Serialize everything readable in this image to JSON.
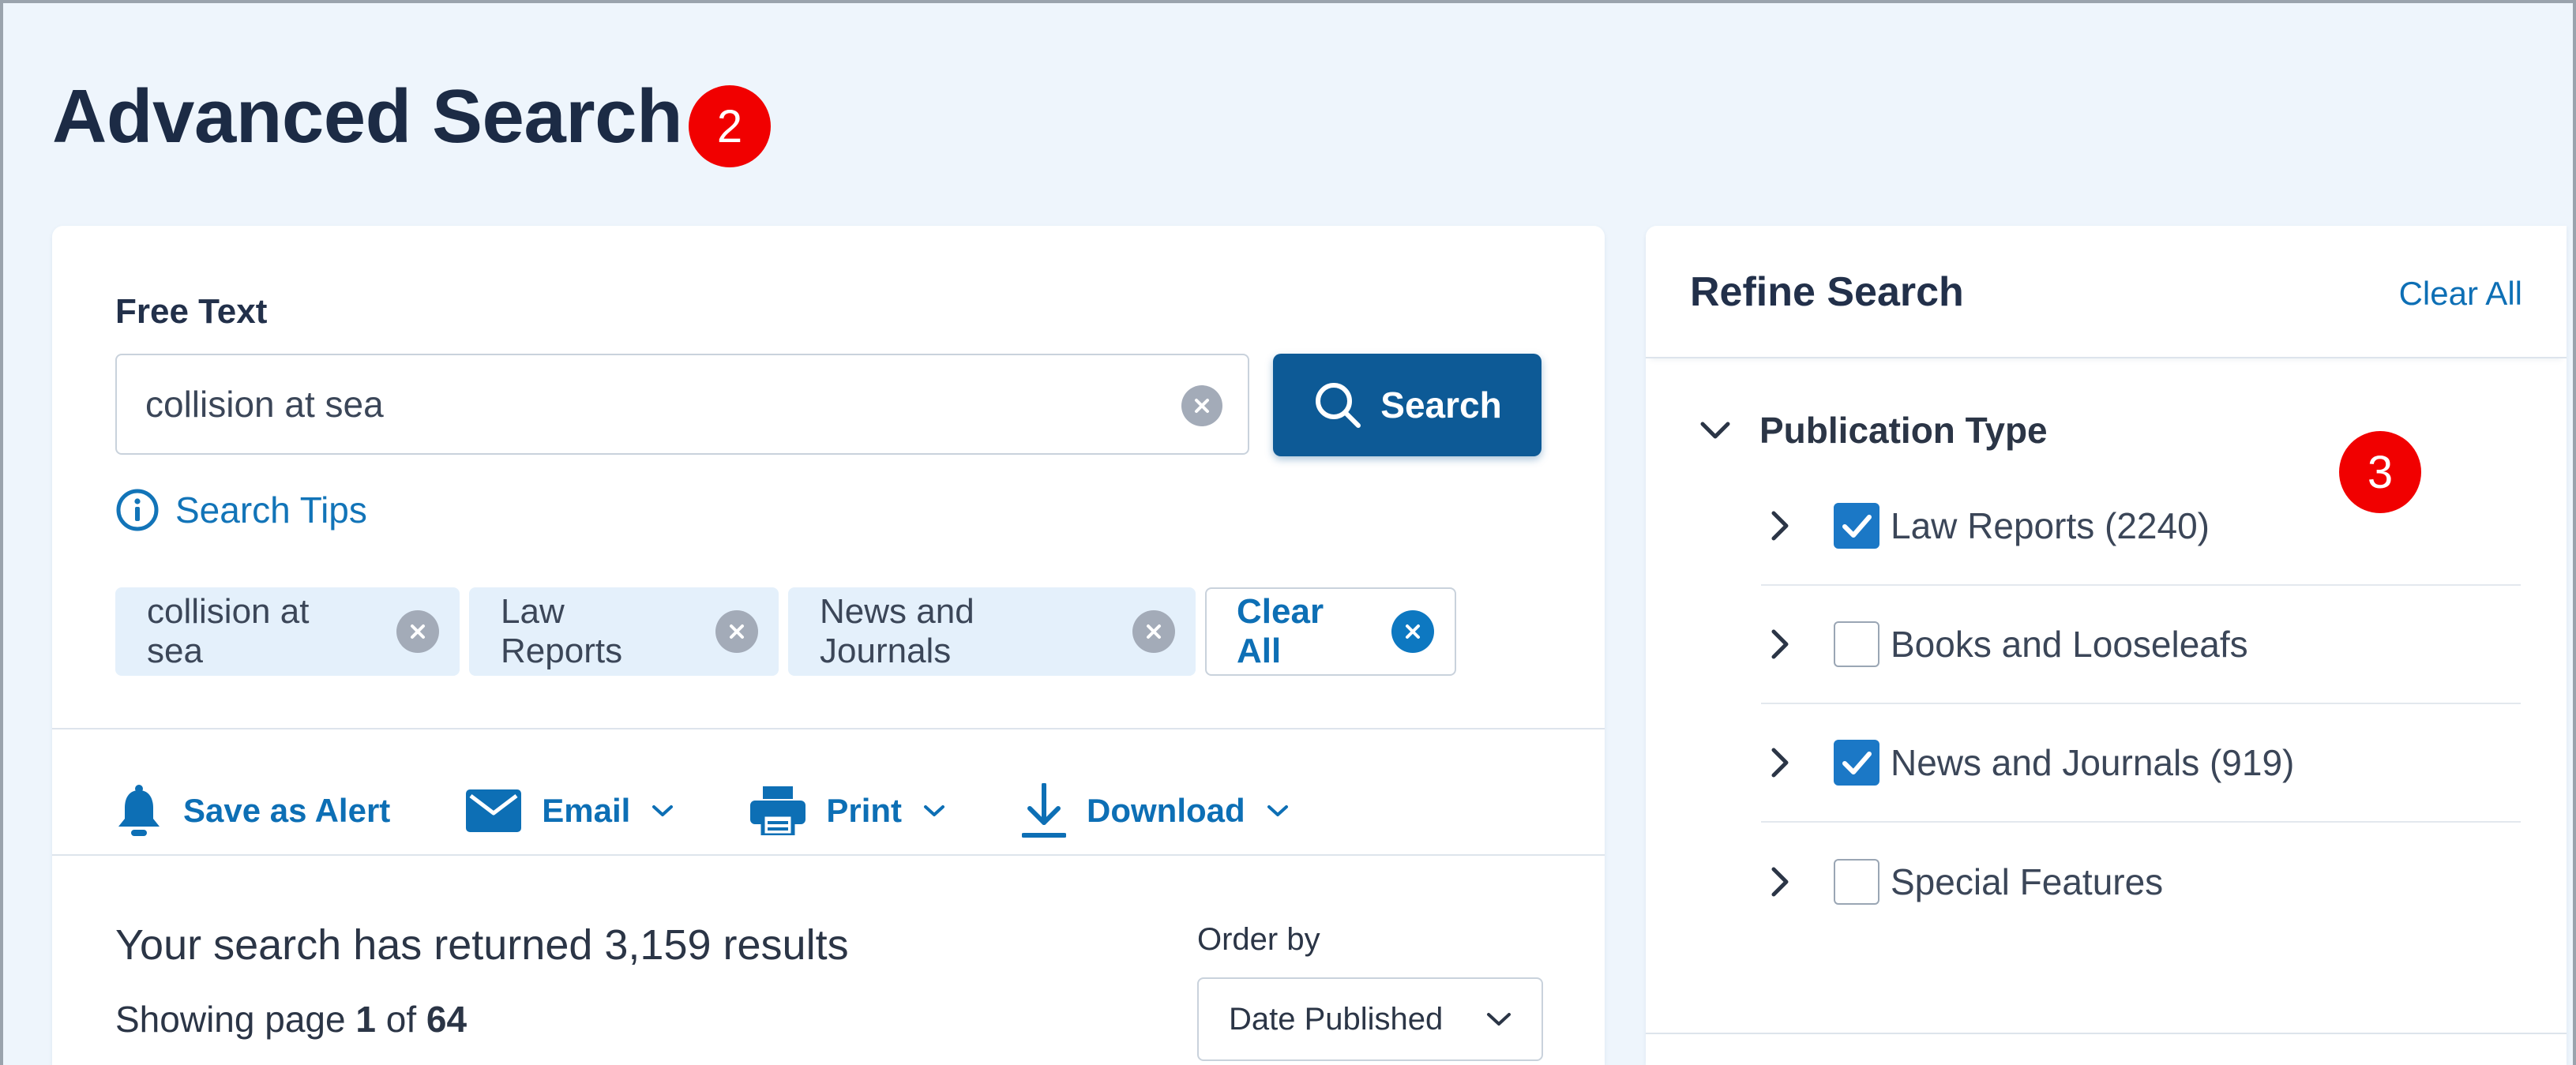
{
  "page": {
    "title": "Advanced Search"
  },
  "annotations": {
    "marker_a": "2",
    "marker_b": "3"
  },
  "search": {
    "label": "Free Text",
    "query": "collision at sea",
    "button_label": "Search",
    "tips_label": "Search Tips"
  },
  "chips": {
    "items": [
      "collision at sea",
      "Law Reports",
      "News and Journals"
    ],
    "clear_all": "Clear All"
  },
  "toolbar": {
    "alert": "Save as Alert",
    "email": "Email",
    "print": "Print",
    "download": "Download"
  },
  "results": {
    "summary": "Your search has returned 3,159 results",
    "showing_prefix": "Showing page",
    "current_page": "1",
    "of_word": "of",
    "total_pages": "64",
    "order_label": "Order by",
    "order_value": "Date Published"
  },
  "refine": {
    "title": "Refine Search",
    "clear_all": "Clear All",
    "section_title": "Publication Type",
    "facets": [
      {
        "label": "Law Reports (2240)",
        "checked": true
      },
      {
        "label": "Books and Looseleafs",
        "checked": false
      },
      {
        "label": "News and Journals (919)",
        "checked": true
      },
      {
        "label": "Special Features",
        "checked": false
      }
    ]
  },
  "colors": {
    "primary": "#0d5a96",
    "link": "#0d6fb5",
    "page_bg": "#eef5fc",
    "marker": "#f10000",
    "checkbox": "#1b78c6"
  },
  "icons": [
    "search-icon",
    "clear-icon",
    "info-icon",
    "bell-icon",
    "envelope-icon",
    "printer-icon",
    "download-icon",
    "chevron-down-icon",
    "chevron-right-icon",
    "check-icon"
  ]
}
